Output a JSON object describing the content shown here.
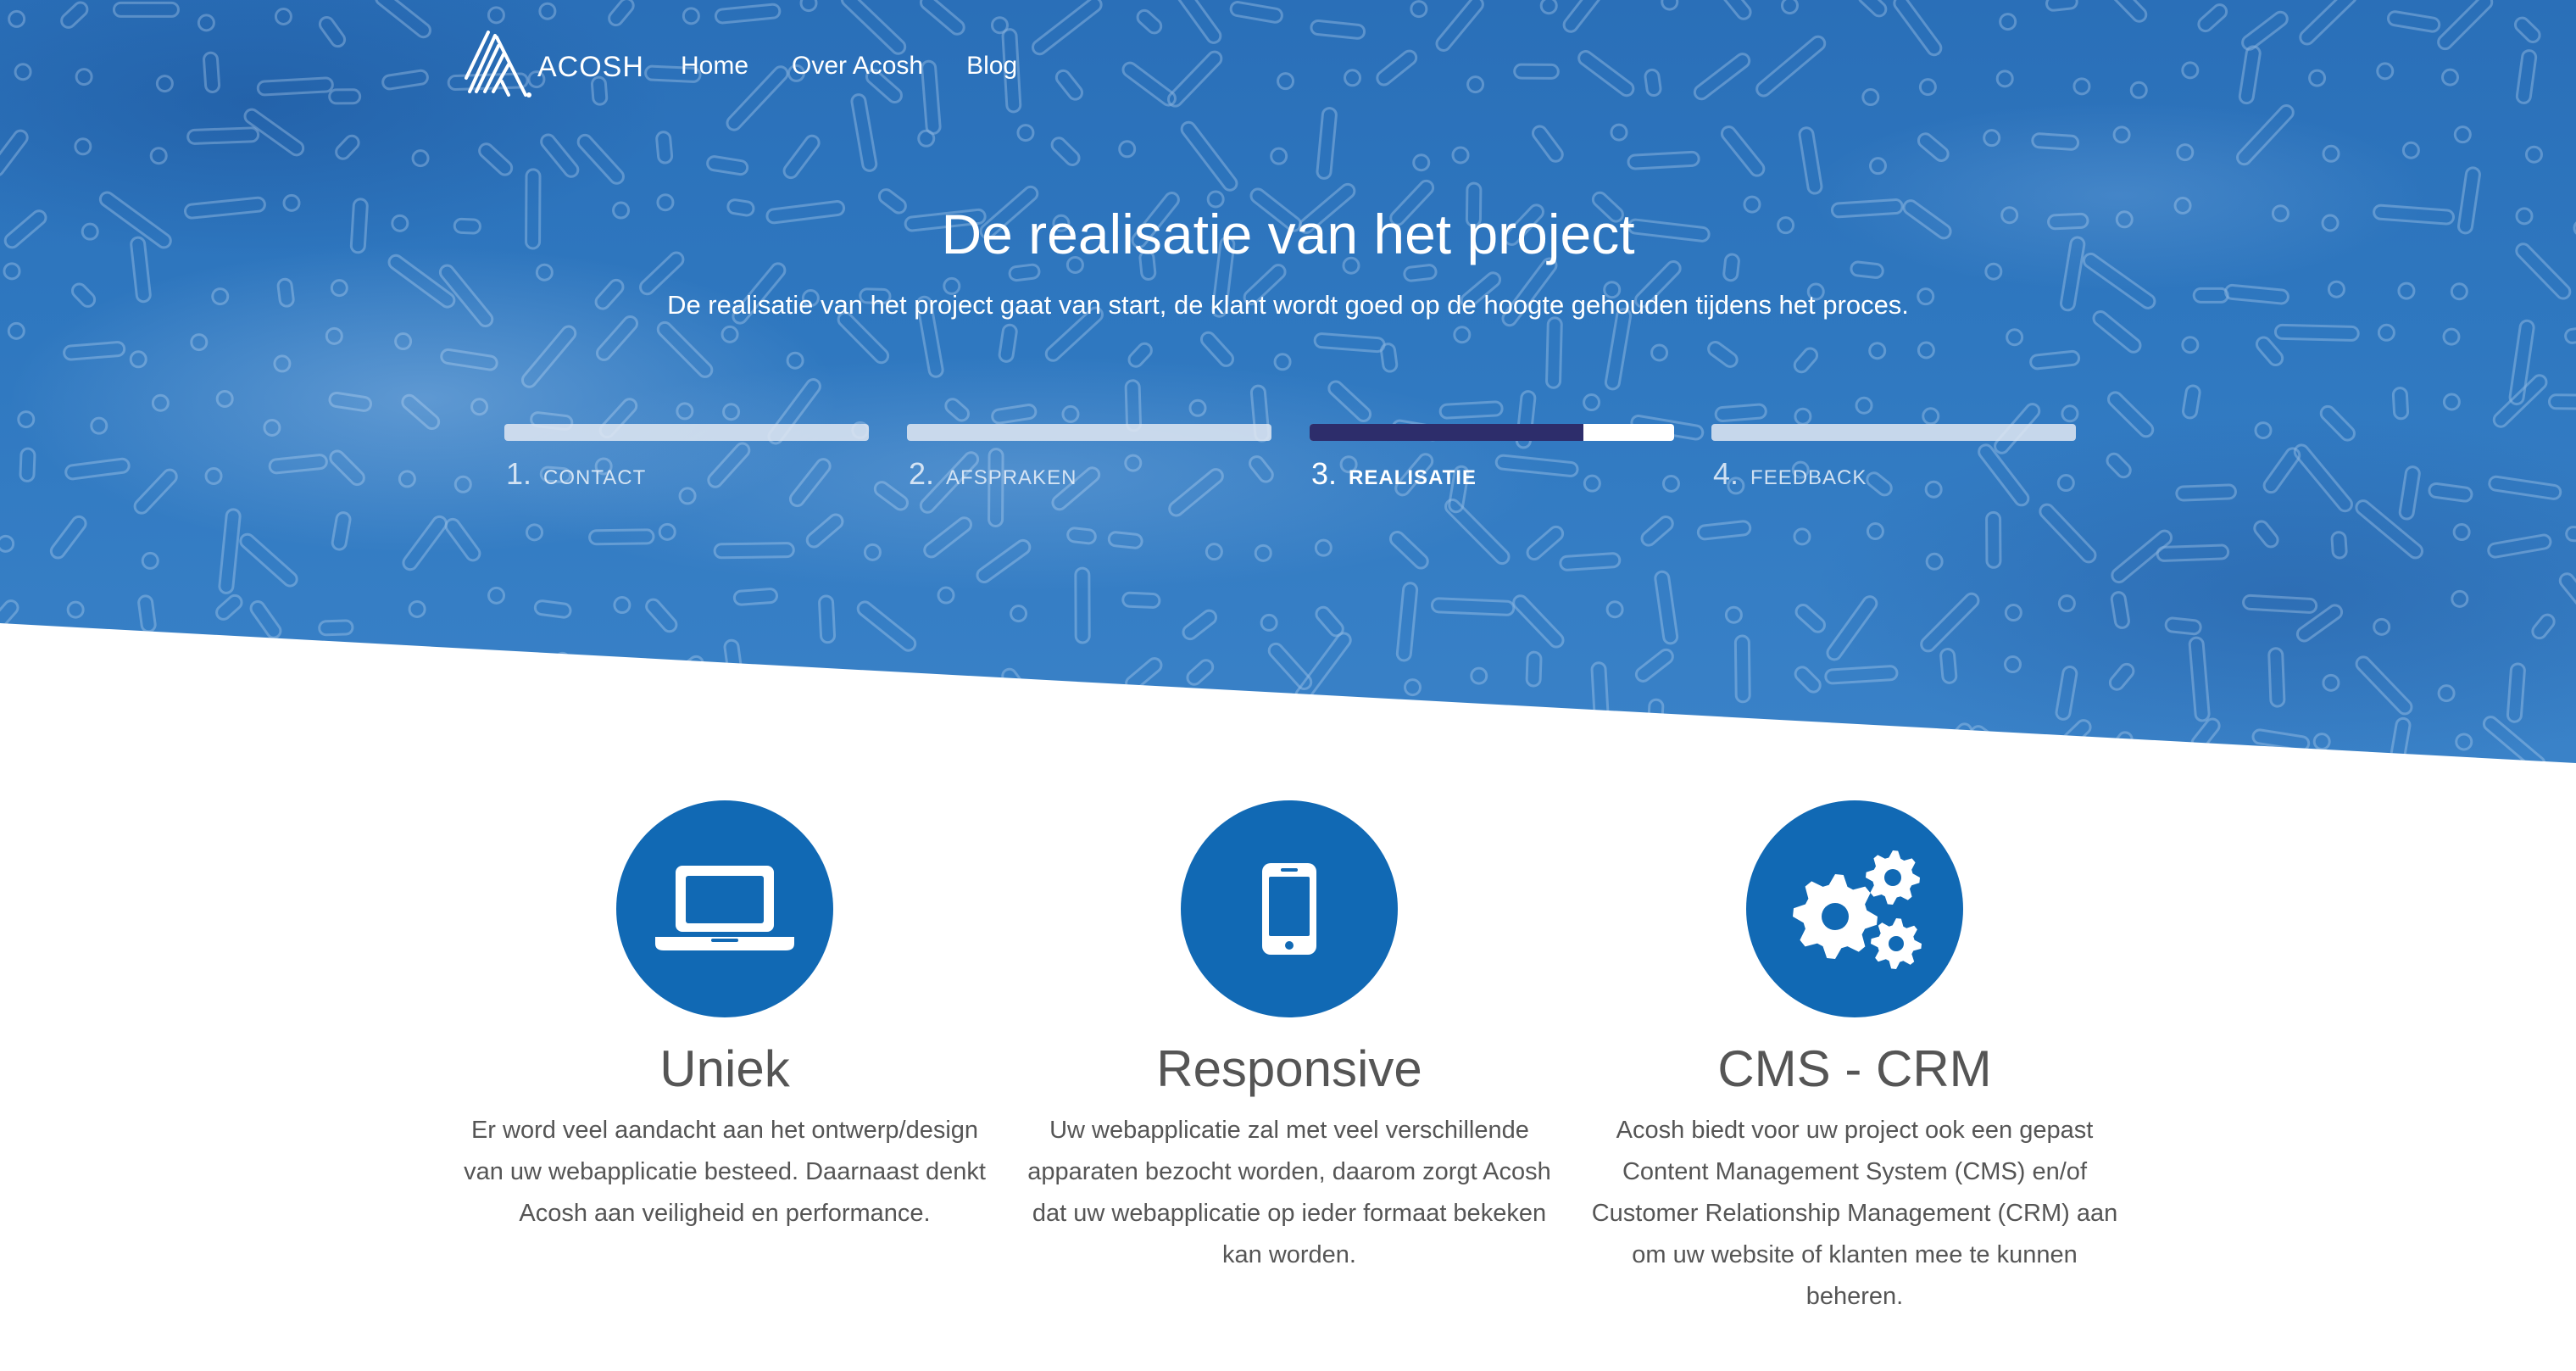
{
  "nav": {
    "brand": "ACOSH",
    "links": [
      {
        "label": "Home"
      },
      {
        "label": "Over Acosh"
      },
      {
        "label": "Blog"
      }
    ]
  },
  "hero": {
    "title": "De realisatie van het project",
    "subtitle": "De realisatie van het project gaat van start, de klant wordt goed op de hoogte gehouden tijdens het proces."
  },
  "steps": [
    {
      "number": "1.",
      "label": "CONTACT",
      "progress": 0
    },
    {
      "number": "2.",
      "label": "AFSPRAKEN",
      "progress": 0
    },
    {
      "number": "3.",
      "label": "REALISATIE",
      "progress": 0.75,
      "current": true
    },
    {
      "number": "4.",
      "label": "FEEDBACK",
      "progress": 0
    }
  ],
  "features": [
    {
      "icon": "laptop-icon",
      "title": "Uniek",
      "text": "Er word veel aandacht aan het ontwerp/design van uw webapplicatie besteed. Daarnaast denkt Acosh aan veiligheid en performance."
    },
    {
      "icon": "smartphone-icon",
      "title": "Responsive",
      "text": "Uw webapplicatie zal met veel verschillende apparaten bezocht worden, daarom zorgt Acosh dat uw webapplicatie op ieder formaat bekeken kan worden."
    },
    {
      "icon": "gears-icon",
      "title": "CMS - CRM",
      "text": "Acosh biedt voor uw project ook een gepast Content Management System (CMS) en/of Customer Relationship Management (CRM) aan om uw website of klanten mee te kunnen beheren."
    }
  ],
  "colors": {
    "hero_blue": "#2f78c0",
    "feature_blue": "#1169b4",
    "progress_dark": "#2d2d6b",
    "text_gray": "#555555"
  }
}
